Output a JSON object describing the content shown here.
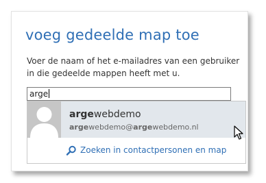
{
  "dialog": {
    "title": "voeg gedeelde map toe",
    "instruction": "Voer de naam of het e-mailadres van een gebruiker in die gedeelde mappen heeft met u."
  },
  "search": {
    "value": "arge"
  },
  "suggestion": {
    "name_match": "arge",
    "name_rest": "webdemo",
    "email_part1": "arge",
    "email_part2": "webdemo@",
    "email_part3": "arge",
    "email_part4": "webdemo.nl",
    "avatar_icon": "person-placeholder-icon"
  },
  "search_contacts": {
    "label": "Zoeken in contactpersonen en map",
    "icon": "search-icon"
  },
  "colors": {
    "accent": "#2f6fb5",
    "suggestion_highlight": "#e2e7ec",
    "avatar_bg": "#c6c6c6"
  }
}
